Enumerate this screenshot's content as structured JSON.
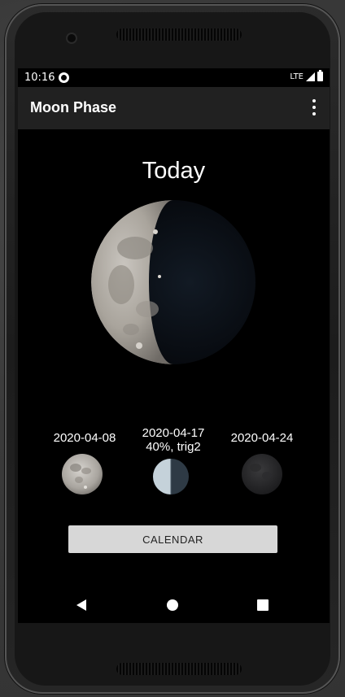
{
  "status_bar": {
    "time": "10:16",
    "network": "LTE"
  },
  "app_bar": {
    "title": "Moon Phase",
    "menu_icon": "more-vert-icon"
  },
  "main": {
    "heading": "Today",
    "main_moon": {
      "illumination_icon": "waxing-crescent-moon-image"
    },
    "phases": [
      {
        "date": "2020-04-08",
        "detail": "",
        "phase": "full-moon"
      },
      {
        "date": "2020-04-17",
        "detail": "40%, trig2",
        "phase": "last-quarter"
      },
      {
        "date": "2020-04-24",
        "detail": "",
        "phase": "new-moon"
      }
    ],
    "calendar_button": "CALENDAR"
  },
  "nav_bar": {
    "back_icon": "back-icon",
    "home_icon": "home-icon",
    "recents_icon": "recents-icon"
  },
  "colors": {
    "app_bar": "#212121",
    "screen_bg": "#000000",
    "button_bg": "#d7d7d7"
  }
}
